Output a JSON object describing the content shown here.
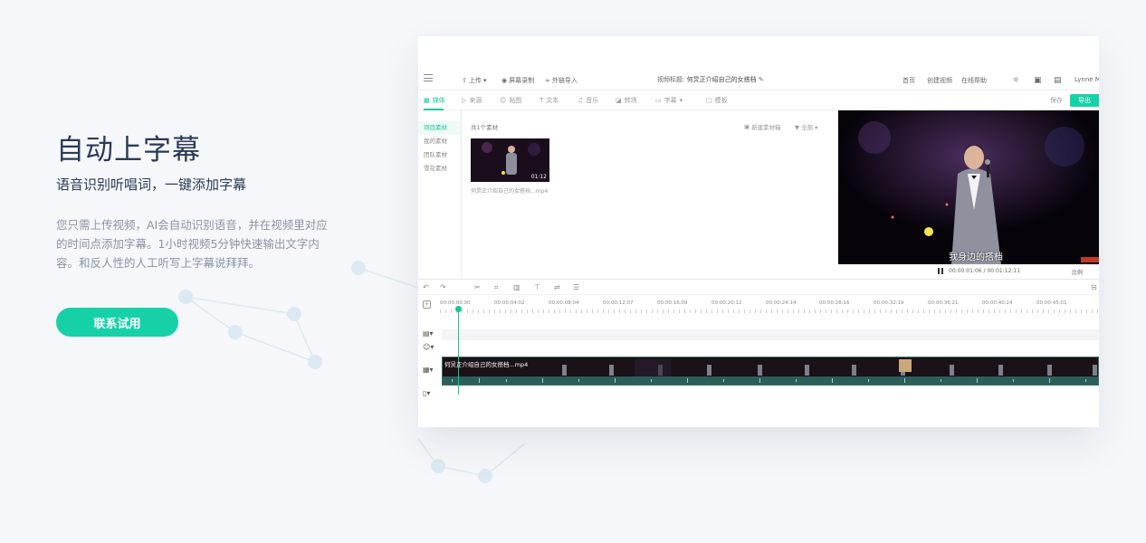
{
  "hero": {
    "title": "自动上字幕",
    "subtitle": "语音识别听唱词，一键添加字幕",
    "description": "您只需上传视频，AI会自动识别语音，并在视频里对应的时间点添加字幕。1小时视频5分钟快速输出文字内容。和反人性的人工听写上字幕说拜拜。",
    "cta_label": "联系试用"
  },
  "app": {
    "toolbar": {
      "upload": "上传",
      "record": "屏幕录制",
      "import": "外链导入",
      "video_title_label": "视频标题:",
      "video_title": "何炅正介绍自己的女搭档",
      "home": "首页",
      "create_video": "创建视频",
      "help": "在线帮助",
      "user": "Lynne M"
    },
    "tabs": [
      {
        "label": "媒体",
        "active": true
      },
      {
        "label": "来源"
      },
      {
        "label": "贴图"
      },
      {
        "label": "文本"
      },
      {
        "label": "音乐"
      },
      {
        "label": "转场"
      },
      {
        "label": "字幕"
      },
      {
        "label": "模板"
      }
    ],
    "save_label": "保存",
    "export_label": "导出",
    "sidebar": [
      {
        "label": "项目素材",
        "active": true
      },
      {
        "label": "我的素材"
      },
      {
        "label": "团队素材"
      },
      {
        "label": "雪花素材"
      }
    ],
    "assets": {
      "count": "共1个素材",
      "new_folder": "新建素材箱",
      "filter": "全部",
      "items": [
        {
          "duration": "01:12",
          "name": "何炅正介绍自己的女搭档...mp4"
        }
      ]
    },
    "preview": {
      "caption": "我身边的搭档",
      "time": "00:00:01:06 / 00:01:12:11",
      "ratio": "比例"
    },
    "timeline": {
      "ticks": [
        "00:00:00:00",
        "00:00:04:02",
        "00:00:08:04",
        "00:00:12:07",
        "00:00:16:09",
        "00:00:20:12",
        "00:00:24:14",
        "00:00:28:16",
        "00:00:32:19",
        "00:00:36:21",
        "00:00:40:24",
        "00:00:45:01"
      ],
      "clip_name": "何炅正介绍自己的女搭档...mp4"
    }
  }
}
